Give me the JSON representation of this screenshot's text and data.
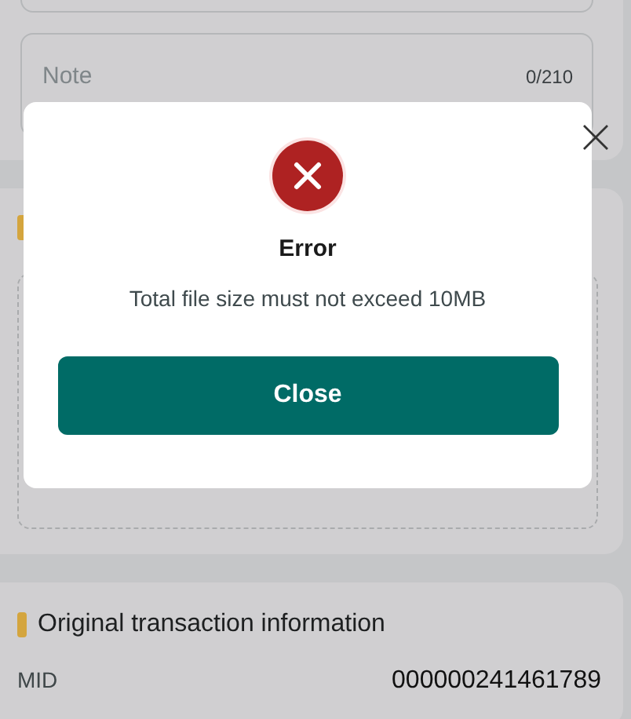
{
  "note_field": {
    "placeholder": "Note",
    "counter": "0/210"
  },
  "transaction_section": {
    "title": "Original transaction information",
    "rows": [
      {
        "label": "MID",
        "value": "000000241461789"
      }
    ]
  },
  "dialog": {
    "title": "Error",
    "message": "Total file size must not exceed 10MB",
    "button": "Close"
  }
}
